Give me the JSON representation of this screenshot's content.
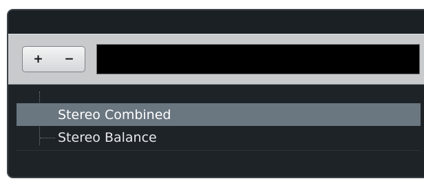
{
  "toolbar": {
    "add_label": "+",
    "remove_label": "−",
    "name_field_value": ""
  },
  "tree": {
    "items": [
      {
        "label": "Stereo Combined",
        "selected": true
      },
      {
        "label": "Stereo Balance",
        "selected": false
      }
    ]
  },
  "colors": {
    "panel_bg": "#1e2328",
    "toolbar_bg": "#c8cacc",
    "selected_row": "#6a7680",
    "field_bg": "#000000"
  }
}
